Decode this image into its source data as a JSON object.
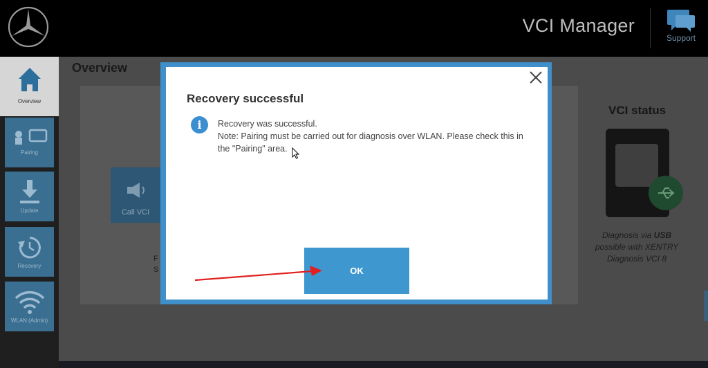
{
  "header": {
    "app_title": "VCI Manager",
    "support_label": "Support",
    "logo_icon": "mercedes-star-icon"
  },
  "sidebar": {
    "items": [
      {
        "label": "Overview",
        "icon": "home-icon",
        "active": true
      },
      {
        "label": "Pairing",
        "icon": "pairing-icon"
      },
      {
        "label": "Update",
        "icon": "download-icon"
      },
      {
        "label": "Recovery",
        "icon": "recovery-icon"
      },
      {
        "label": "WLAN (Admin)",
        "icon": "wifi-icon"
      }
    ]
  },
  "main": {
    "title": "Overview",
    "call_vci_label": "Call VCI",
    "partial_text_1": "F",
    "partial_text_2": "S",
    "vci_status": {
      "title": "VCI status",
      "desc_prefix": "Diagnosis via ",
      "desc_bold": "USB",
      "desc_line2": "possible with XENTRY",
      "desc_line3": "Diagnosis VCI 8"
    }
  },
  "dialog": {
    "title": "Recovery successful",
    "message_line1": "Recovery was successful.",
    "message_line2": "Note: Pairing must be carried out for diagnosis over WLAN. Please check this in the \"Pairing\" area.",
    "ok_label": "OK",
    "info_symbol": "i"
  },
  "colors": {
    "accent": "#3f97d0",
    "header_bg": "#000000",
    "sidebar_tile": "#3a6f92",
    "annotation_arrow": "#e02020"
  }
}
